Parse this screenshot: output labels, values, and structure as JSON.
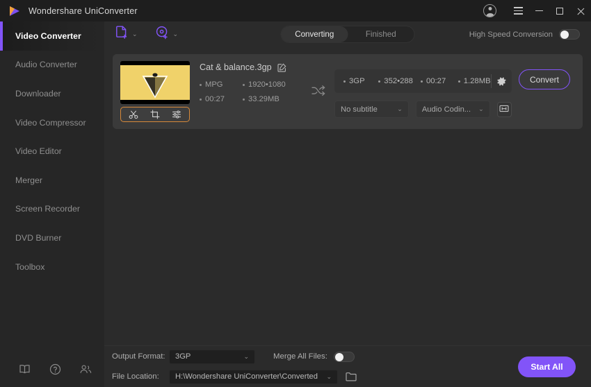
{
  "window": {
    "title": "Wondershare UniConverter",
    "controls": {
      "menu": "≡",
      "minimize": "–",
      "maximize": "□",
      "close": "✕"
    }
  },
  "sidebar": {
    "items": [
      {
        "label": "Video Converter",
        "active": true
      },
      {
        "label": "Audio Converter",
        "active": false
      },
      {
        "label": "Downloader",
        "active": false
      },
      {
        "label": "Video Compressor",
        "active": false
      },
      {
        "label": "Video Editor",
        "active": false
      },
      {
        "label": "Merger",
        "active": false
      },
      {
        "label": "Screen Recorder",
        "active": false
      },
      {
        "label": "DVD Burner",
        "active": false
      },
      {
        "label": "Toolbox",
        "active": false
      }
    ],
    "footer_icons": [
      "book-icon",
      "help-icon",
      "community-icon"
    ]
  },
  "toolbar": {
    "add_files_icon": "file-plus-icon",
    "add_disc_icon": "disc-plus-icon",
    "dropdown_caret": "⌄",
    "tabs": [
      {
        "label": "Converting",
        "active": true
      },
      {
        "label": "Finished",
        "active": false
      }
    ],
    "high_speed_label": "High Speed Conversion",
    "high_speed_enabled": false
  },
  "task": {
    "file_name": "Cat & balance.3gp",
    "edit_icon": "pencil-square-icon",
    "source": {
      "format": "MPG",
      "resolution": "1920•1080",
      "duration": "00:27",
      "size": "33.29MB"
    },
    "thumb_tools": [
      {
        "name": "trim-icon",
        "glyph": "✂"
      },
      {
        "name": "crop-icon",
        "glyph": "⌐"
      },
      {
        "name": "effect-icon",
        "glyph": "≡"
      }
    ],
    "shuffle_icon": "shuffle-icon",
    "output": {
      "format": "3GP",
      "resolution": "352•288",
      "duration": "00:27",
      "size": "1.28MB",
      "settings_icon": "gear-icon"
    },
    "subtitle_select": "No subtitle",
    "audio_select": "Audio Codin...",
    "media_button_icon": "media-frame-icon",
    "convert_label": "Convert"
  },
  "bottom": {
    "output_format_label": "Output Format:",
    "output_format_value": "3GP",
    "merge_label": "Merge All Files:",
    "merge_enabled": false,
    "file_location_label": "File Location:",
    "file_location_value": "H:\\Wondershare UniConverter\\Converted",
    "folder_icon": "folder-icon",
    "start_all_label": "Start All"
  },
  "colors": {
    "accent": "#8254f8",
    "thumb": "#f0d26a",
    "edit_border": "#d88a3a",
    "window_bg": "#262626",
    "main_bg": "#2b2b2b",
    "card_bg": "#3a3a3a"
  }
}
